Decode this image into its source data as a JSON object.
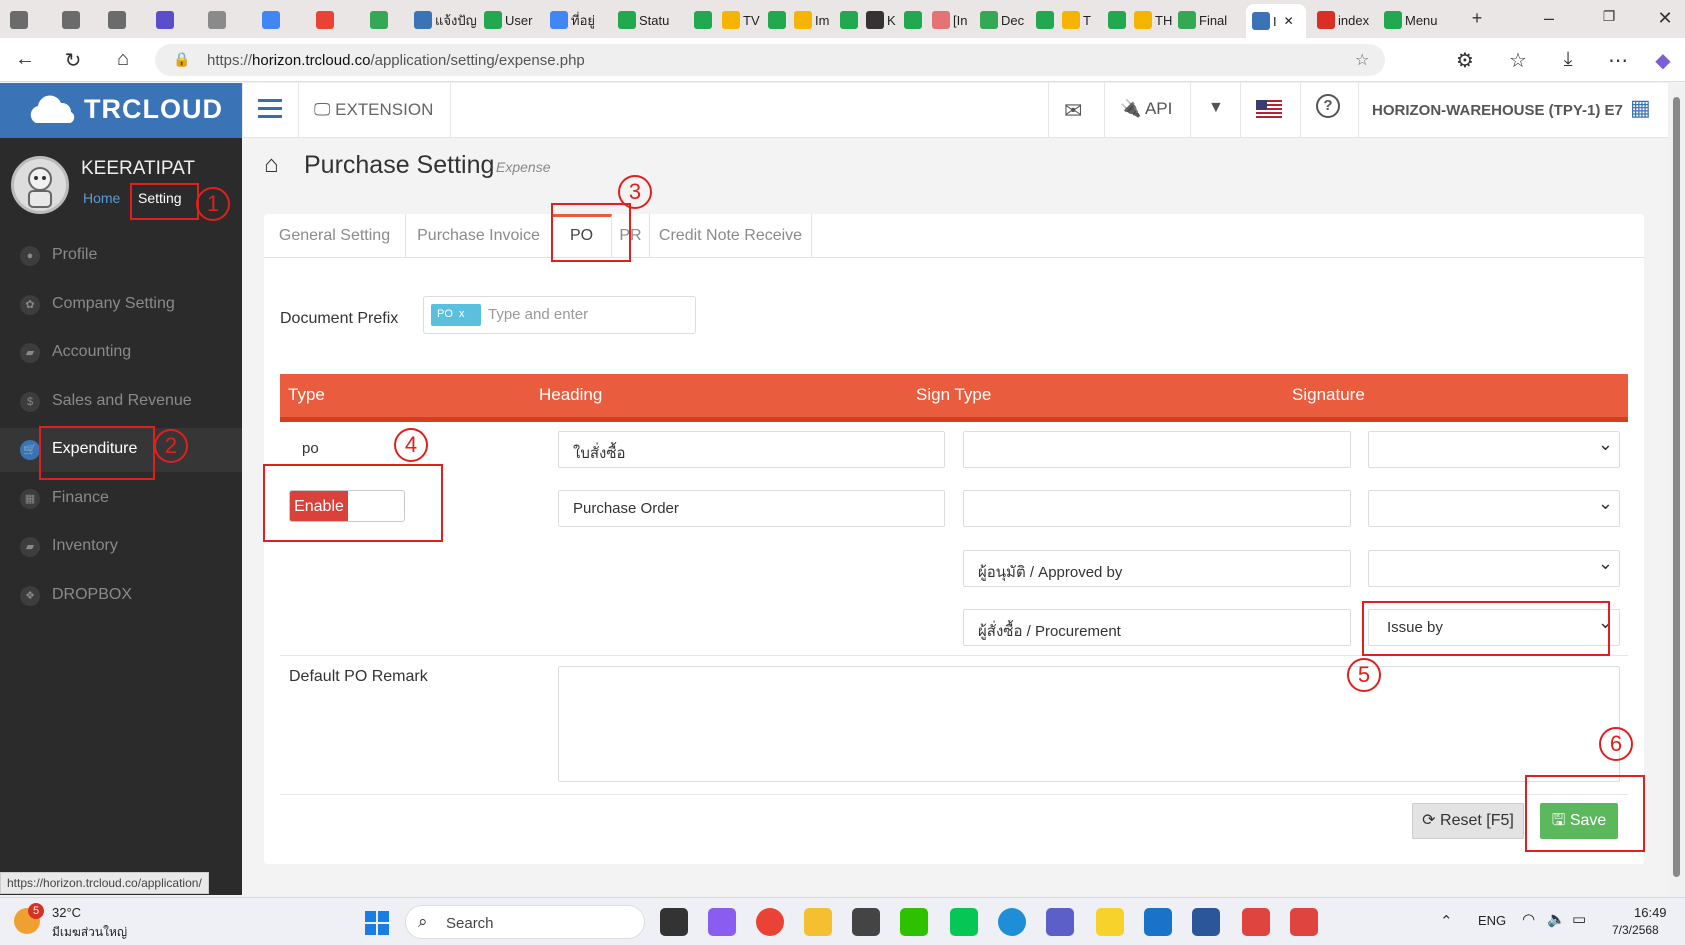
{
  "browser": {
    "tabs": [
      {
        "label": "",
        "color": "#6b6b6b"
      },
      {
        "label": "",
        "color": "#6b6b6b"
      },
      {
        "label": "",
        "color": "#6b6b6b"
      },
      {
        "label": "",
        "color": "#5a4ec9"
      },
      {
        "label": "",
        "color": "#8a8a8a"
      },
      {
        "label": "",
        "color": "#4285f4"
      },
      {
        "label": "",
        "color": "#ea4335"
      },
      {
        "label": "",
        "color": "#34a853"
      },
      {
        "label": "แจ้งปัญ",
        "color": "#3a73b6"
      },
      {
        "label": "User",
        "color": "#22a94f"
      },
      {
        "label": "ที่อยู่",
        "color": "#4285f4"
      },
      {
        "label": "Statu",
        "color": "#22a94f"
      },
      {
        "label": "",
        "color": "#22a94f"
      },
      {
        "label": "TV",
        "color": "#f4b400"
      },
      {
        "label": "",
        "color": "#22a94f"
      },
      {
        "label": "Im",
        "color": "#f4b400"
      },
      {
        "label": "",
        "color": "#22a94f"
      },
      {
        "label": "K",
        "color": "#333333"
      },
      {
        "label": "",
        "color": "#22a94f"
      },
      {
        "label": "[In",
        "color": "#e57373"
      },
      {
        "label": "Dec",
        "color": "#34a853"
      },
      {
        "label": "",
        "color": "#22a94f"
      },
      {
        "label": "T",
        "color": "#f4b400"
      },
      {
        "label": "",
        "color": "#22a94f"
      },
      {
        "label": "TH",
        "color": "#f4b400"
      },
      {
        "label": "Final",
        "color": "#34a853"
      },
      {
        "label": "I",
        "color": "#3a73b6",
        "active": true
      },
      {
        "label": "index",
        "color": "#d93025"
      },
      {
        "label": "Menu",
        "color": "#22a94f"
      }
    ],
    "url_prefix": "https://",
    "url_host": "horizon.trcloud.co",
    "url_path": "/application/setting/expense.php",
    "status_url": "https://horizon.trcloud.co/application/"
  },
  "app": {
    "logo": "TRCLOUD",
    "user_name": "KEERATIPAT",
    "home_link": "Home",
    "setting_link": "Setting",
    "brand_color": "#3a73b6",
    "accent_color": "#e95c3e"
  },
  "sidebar": {
    "items": [
      {
        "label": "Profile",
        "icon": "user-icon",
        "glyph": "●"
      },
      {
        "label": "Company Setting",
        "icon": "gear-icon",
        "glyph": "✿"
      },
      {
        "label": "Accounting",
        "icon": "book-icon",
        "glyph": "▰"
      },
      {
        "label": "Sales and Revenue",
        "icon": "dollar-icon",
        "glyph": "$"
      },
      {
        "label": "Expenditure",
        "icon": "cart-icon",
        "glyph": "🛒",
        "active": true
      },
      {
        "label": "Finance",
        "icon": "calendar-icon",
        "glyph": "▦"
      },
      {
        "label": "Inventory",
        "icon": "box-icon",
        "glyph": "▰"
      },
      {
        "label": "DROPBOX",
        "icon": "dropbox-icon",
        "glyph": "❖"
      }
    ]
  },
  "topbar": {
    "extension": "EXTENSION",
    "api": "API",
    "company": "HORIZON-WAREHOUSE (TPY-1) E7"
  },
  "page": {
    "title": "Purchase Setting",
    "subtitle": "Expense"
  },
  "tabs": [
    {
      "label": "General Setting"
    },
    {
      "label": "Purchase Invoice"
    },
    {
      "label": "PO",
      "active": true
    },
    {
      "label": "PR"
    },
    {
      "label": "Credit Note Receive"
    }
  ],
  "form": {
    "prefix_label": "Document Prefix",
    "prefix_tag": "PO",
    "prefix_tag_remove": "x",
    "prefix_placeholder": "Type and enter",
    "table_headers": [
      "Type",
      "Heading",
      "Sign Type",
      "Signature"
    ],
    "type_value": "po",
    "toggle_label": "Enable",
    "heading_1": "ใบสั่งซื้อ",
    "heading_2": "Purchase Order",
    "sign_type_1": "",
    "sign_type_2": "",
    "sign_type_3": "ผู้อนุมัติ / Approved by",
    "sign_type_4": "ผู้สั่งซื้อ / Procurement",
    "signature_1": "",
    "signature_2": "",
    "signature_3": "",
    "signature_4": "Issue by",
    "remark_label": "Default PO Remark",
    "remark_value": ""
  },
  "buttons": {
    "reset": "Reset [F5]",
    "save": "Save"
  },
  "annotations": [
    "1",
    "2",
    "3",
    "4",
    "5",
    "6"
  ],
  "taskbar": {
    "weather_badge": "5",
    "temperature": "32°C",
    "weather_text": "มีเมฆส่วนใหญ่",
    "search": "Search",
    "lang": "ENG",
    "time": "16:49",
    "date": "7/3/2568"
  }
}
